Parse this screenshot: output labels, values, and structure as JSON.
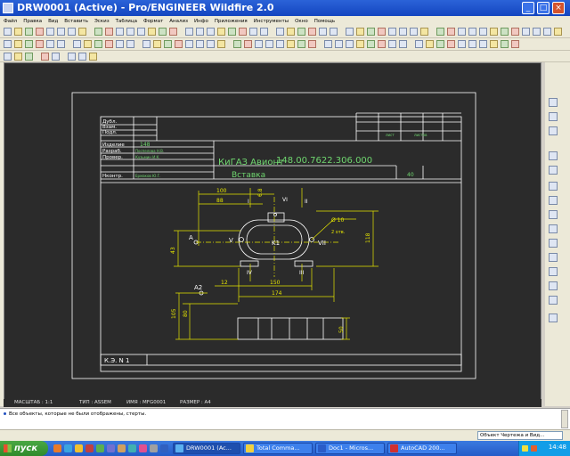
{
  "window": {
    "title": "DRW0001 (Active) - Pro/ENGINEER Wildfire 2.0"
  },
  "menu": [
    "Файл",
    "Правка",
    "Вид",
    "Вставить",
    "Эскиз",
    "Таблица",
    "Формат",
    "Анализ",
    "Инфо",
    "Приложения",
    "Инструменты",
    "Окно",
    "Помощь"
  ],
  "drawing": {
    "title_block": {
      "row_labels": [
        "Дубл.",
        "Взам.",
        "Подл.",
        "Изделие",
        "Разраб.",
        "Провер.",
        "Нконтр."
      ],
      "product": "148",
      "developer": "Поспелова Н.В.",
      "checker": "Кузьмин И.К.",
      "norm_control": "Ермаков Ю.Г.",
      "company": "КиГАЗ Авионт",
      "designation": "148.00.7622.306.000",
      "part_name": "Вставка",
      "sheet_num": "40",
      "lit_label": "лист",
      "sheets_label": "листов",
      "bottom_label": "К.Э. N 1"
    },
    "dimensions": {
      "d100": "100",
      "d88": "88",
      "d68": "6.8",
      "d10": "Ø 10",
      "d2holes": "2 отв.",
      "d118": "118",
      "d43": "43",
      "d12": "12",
      "d150": "150",
      "d174": "174",
      "d105": "105",
      "d80": "80",
      "d50": "50"
    },
    "labels": {
      "A": "A",
      "A2": "A2",
      "V": "V",
      "VII": "VII",
      "K1": "K1",
      "I": "I",
      "II": "II",
      "VI": "VI",
      "IV": "IV",
      "III": "III"
    }
  },
  "info": {
    "scale": "МАСШТАБ : 1:1",
    "type": "ТИП : ASSEM",
    "name": "ИМЯ : MFG0001",
    "size": "РАЗМЕР : A4"
  },
  "message": "Все объекты, которые не были отображены, стерты.",
  "filter": "Объект Чертежа и Вид...",
  "taskbar": {
    "start": "пуск",
    "tasks": [
      "DRW0001 (Ac...",
      "Total Comma...",
      "Doc1 - Micros...",
      "AutoCAD 200..."
    ],
    "clock": "14:48"
  },
  "colors": {
    "drawing_bg": "#2b2b2b",
    "line": "#ffffff",
    "dimension": "#e6e600",
    "text_green": "#6fd66f"
  }
}
